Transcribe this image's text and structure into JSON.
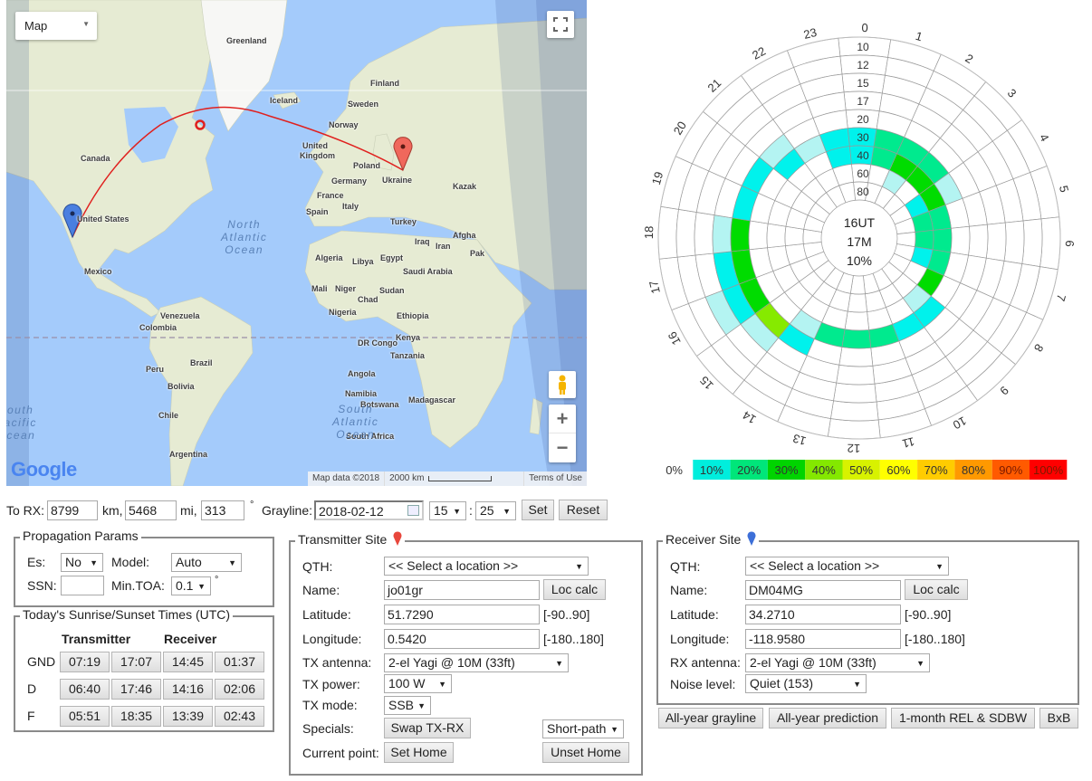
{
  "map": {
    "type_select": "Map",
    "labels": [
      "Greenland",
      "Iceland",
      "Finland",
      "Sweden",
      "Norway",
      "Canada",
      "United",
      "Kingdom",
      "Poland",
      "Germany",
      "Ukraine",
      "France",
      "Spain",
      "Italy",
      "Turkey",
      "Kazak",
      "United States",
      "Mexico",
      "Algeria",
      "Libya",
      "Egypt",
      "Iraq",
      "Iran",
      "Afgha",
      "Saudi Arabia",
      "Pak",
      "Mali",
      "Niger",
      "Chad",
      "Sudan",
      "Nigeria",
      "Ethiopia",
      "Venezuela",
      "Colombia",
      "DR Congo",
      "Kenya",
      "Tanzania",
      "Peru",
      "Brazil",
      "Angola",
      "Bolivia",
      "Namibia",
      "Botswana",
      "Madagascar",
      "South Africa",
      "Chile",
      "Argentina"
    ],
    "oceans": [
      "North\nAtlantic\nOcean",
      "South\nPacific\nOcean",
      "South\nAtlantic\nOcean"
    ],
    "logo": "Google",
    "attribution": "Map data ©2018",
    "scale": "2000 km",
    "terms": "Terms of Use",
    "zoom_in": "+",
    "zoom_out": "−",
    "colors": {
      "ocean": "#a4cbfb",
      "land": "#e6ebd3",
      "path": "#e0201e",
      "tx_pin": "#f0685c",
      "rx_pin": "#4a7fe0"
    }
  },
  "toolbar": {
    "to_rx_label": "To RX:",
    "km_value": "8799",
    "km_unit": "km,",
    "mi_value": "5468",
    "mi_unit": "mi,",
    "bearing_value": "313",
    "deg_unit": "°",
    "grayline_label": "Grayline:",
    "grayline_date": "2018-02-12",
    "hour": "15",
    "colon": ":",
    "minute": "25",
    "set": "Set",
    "reset": "Reset"
  },
  "prop_params": {
    "legend": "Propagation Params",
    "es_label": "Es:",
    "es_value": "No",
    "model_label": "Model:",
    "model_value": "Auto",
    "ssn_label": "SSN:",
    "ssn_value": "",
    "min_toa_label": "Min.TOA:",
    "min_toa_value": "0.1",
    "deg": "°"
  },
  "sun_times": {
    "legend": "Today's Sunrise/Sunset Times (UTC)",
    "col_tx": "Transmitter",
    "col_rx": "Receiver",
    "rows": [
      {
        "label": "GND",
        "values": [
          "07:19",
          "17:07",
          "14:45",
          "01:37"
        ]
      },
      {
        "label": "D",
        "values": [
          "06:40",
          "17:46",
          "14:16",
          "02:06"
        ]
      },
      {
        "label": "F",
        "values": [
          "05:51",
          "18:35",
          "13:39",
          "02:43"
        ]
      }
    ]
  },
  "tx_site": {
    "legend": "Transmitter Site",
    "qth_label": "QTH:",
    "qth_value": "<< Select a location >>",
    "name_label": "Name:",
    "name_value": "jo01gr",
    "loc_calc": "Loc calc",
    "lat_label": "Latitude:",
    "lat_value": "51.7290",
    "lat_range": "[-90..90]",
    "lon_label": "Longitude:",
    "lon_value": "0.5420",
    "lon_range": "[-180..180]",
    "antenna_label": "TX antenna:",
    "antenna_value": "2-el Yagi @ 10M (33ft)",
    "power_label": "TX power:",
    "power_value": "100 W",
    "mode_label": "TX mode:",
    "mode_value": "SSB",
    "specials_label": "Specials:",
    "swap": "Swap TX-RX",
    "path_value": "Short-path",
    "current_label": "Current point:",
    "set_home": "Set Home",
    "unset_home": "Unset Home"
  },
  "rx_site": {
    "legend": "Receiver Site",
    "qth_label": "QTH:",
    "qth_value": "<< Select a location >>",
    "name_label": "Name:",
    "name_value": "DM04MG",
    "loc_calc": "Loc calc",
    "lat_label": "Latitude:",
    "lat_value": "34.2710",
    "lat_range": "[-90..90]",
    "lon_label": "Longitude:",
    "lon_value": "-118.9580",
    "lon_range": "[-180..180]",
    "antenna_label": "RX antenna:",
    "antenna_value": "2-el Yagi @ 10M (33ft)",
    "noise_label": "Noise level:",
    "noise_value": "Quiet (153)"
  },
  "actions": {
    "grayline": "All-year grayline",
    "prediction": "All-year prediction",
    "rel": "1-month REL & SDBW",
    "bxb": "BxB"
  },
  "chart_data": {
    "type": "heatmap",
    "projection": "polar",
    "hours": [
      "0",
      "1",
      "2",
      "3",
      "4",
      "5",
      "6",
      "7",
      "8",
      "9",
      "10",
      "11",
      "12",
      "13",
      "14",
      "15",
      "16",
      "17",
      "18",
      "19",
      "20",
      "21",
      "22",
      "23"
    ],
    "rings": [
      "10",
      "12",
      "15",
      "17",
      "20",
      "30",
      "40",
      "60",
      "80"
    ],
    "center_labels": [
      "16UT",
      "17M",
      "10%"
    ],
    "cells": [
      {
        "hour": 0,
        "values": {
          "30": 10,
          "40": 10
        }
      },
      {
        "hour": 1,
        "values": {
          "30": 20,
          "40": 20
        }
      },
      {
        "hour": 2,
        "values": {
          "30": 20,
          "40": 30,
          "60": 5
        }
      },
      {
        "hour": 3,
        "values": {
          "30": 20,
          "40": 30
        }
      },
      {
        "hour": 4,
        "values": {
          "30": 5,
          "40": 30,
          "60": 10
        }
      },
      {
        "hour": 5,
        "values": {
          "40": 20,
          "60": 20
        }
      },
      {
        "hour": 6,
        "values": {
          "40": 20,
          "60": 20
        }
      },
      {
        "hour": 7,
        "values": {
          "40": 20,
          "60": 10
        }
      },
      {
        "hour": 8,
        "values": {
          "40": 30
        }
      },
      {
        "hour": 9,
        "values": {
          "30": 10,
          "40": 5
        }
      },
      {
        "hour": 10,
        "values": {
          "30": 10
        }
      },
      {
        "hour": 11,
        "values": {
          "30": 20
        }
      },
      {
        "hour": 12,
        "values": {
          "30": 20
        }
      },
      {
        "hour": 13,
        "values": {
          "30": 20
        }
      },
      {
        "hour": 14,
        "values": {
          "20": 10,
          "30": 5
        }
      },
      {
        "hour": 15,
        "values": {
          "17": 5,
          "20": 40
        }
      },
      {
        "hour": 16,
        "values": {
          "15": 5,
          "17": 10,
          "20": 30
        }
      },
      {
        "hour": 17,
        "values": {
          "17": 10,
          "20": 30
        }
      },
      {
        "hour": 18,
        "values": {
          "17": 5,
          "20": 30
        }
      },
      {
        "hour": 19,
        "values": {
          "20": 10
        }
      },
      {
        "hour": 20,
        "values": {
          "20": 10
        }
      },
      {
        "hour": 21,
        "values": {
          "20": 5,
          "30": 10
        }
      },
      {
        "hour": 22,
        "values": {
          "30": 5
        }
      },
      {
        "hour": 23,
        "values": {
          "30": 10,
          "40": 10
        }
      }
    ],
    "legend": [
      {
        "label": "0%",
        "value": 0,
        "color": "#ffffff"
      },
      {
        "label": "10%",
        "value": 10,
        "color": "#00eedd"
      },
      {
        "label": "20%",
        "value": 20,
        "color": "#00e67a"
      },
      {
        "label": "30%",
        "value": 30,
        "color": "#00d400"
      },
      {
        "label": "40%",
        "value": 40,
        "color": "#84e800"
      },
      {
        "label": "50%",
        "value": 50,
        "color": "#d8f200"
      },
      {
        "label": "60%",
        "value": 60,
        "color": "#ffff00"
      },
      {
        "label": "70%",
        "value": 70,
        "color": "#ffcc00"
      },
      {
        "label": "80%",
        "value": 80,
        "color": "#ff9900"
      },
      {
        "label": "90%",
        "value": 90,
        "color": "#ff5a00"
      },
      {
        "label": "100%",
        "value": 100,
        "color": "#ff0000"
      }
    ],
    "cell_colors": {
      "5": "#b4f4f2",
      "10": "#00f2ec",
      "20": "#00ea8e",
      "30": "#00dc00",
      "40": "#86ea00"
    },
    "legend_placement": "bottom"
  }
}
